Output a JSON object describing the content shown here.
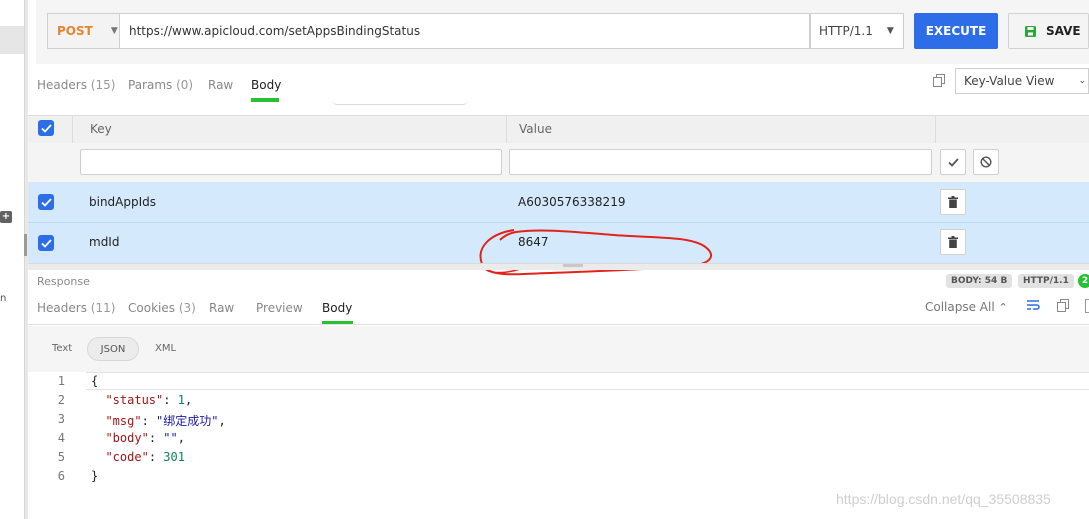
{
  "left": {
    "add_glyph": "+",
    "partial_char": "n"
  },
  "request": {
    "method": "POST",
    "url": "https://www.apicloud.com/setAppsBindingStatus",
    "http_version": "HTTP/1.1",
    "execute_label": "EXECUTE",
    "save_label": "SAVE"
  },
  "request_tabs": [
    {
      "label": "Headers",
      "count": "(15)"
    },
    {
      "label": "Params",
      "count": "(0)"
    },
    {
      "label": "Raw",
      "count": ""
    },
    {
      "label": "Body",
      "count": ""
    }
  ],
  "view_select": "Key-Value View",
  "table": {
    "headers": {
      "key": "Key",
      "value": "Value"
    },
    "rows": [
      {
        "key": "bindAppIds",
        "value": "A6030576338219"
      },
      {
        "key": "mdId",
        "value": "8647"
      }
    ]
  },
  "response": {
    "label": "Response",
    "body_size": "BODY: 54 B",
    "http_version": "HTTP/1.1",
    "status_code_partial": "2",
    "tabs": [
      {
        "label": "Headers",
        "count": "(11)"
      },
      {
        "label": "Cookies",
        "count": "(3)"
      },
      {
        "label": "Raw",
        "count": ""
      },
      {
        "label": "Preview",
        "count": ""
      },
      {
        "label": "Body",
        "count": ""
      }
    ],
    "collapse_all": "Collapse All",
    "formats": [
      "Text",
      "JSON",
      "XML"
    ],
    "line_numbers": [
      "1",
      "2",
      "3",
      "4",
      "5",
      "6"
    ],
    "json": {
      "open": "{",
      "close": "}",
      "status_key": "\"status\"",
      "status_val": "1",
      "msg_key": "\"msg\"",
      "msg_val": "\"绑定成功\"",
      "body_key": "\"body\"",
      "body_val": "\"\"",
      "code_key": "\"code\"",
      "code_val": "301"
    }
  },
  "watermark": "https://blog.csdn.net/qq_35508835",
  "colors": {
    "accent": "#2d6de8",
    "active_tab": "#27c234",
    "method": "#e6852f",
    "row_selected": "#d4eafc",
    "annotation": "#e0241b"
  }
}
